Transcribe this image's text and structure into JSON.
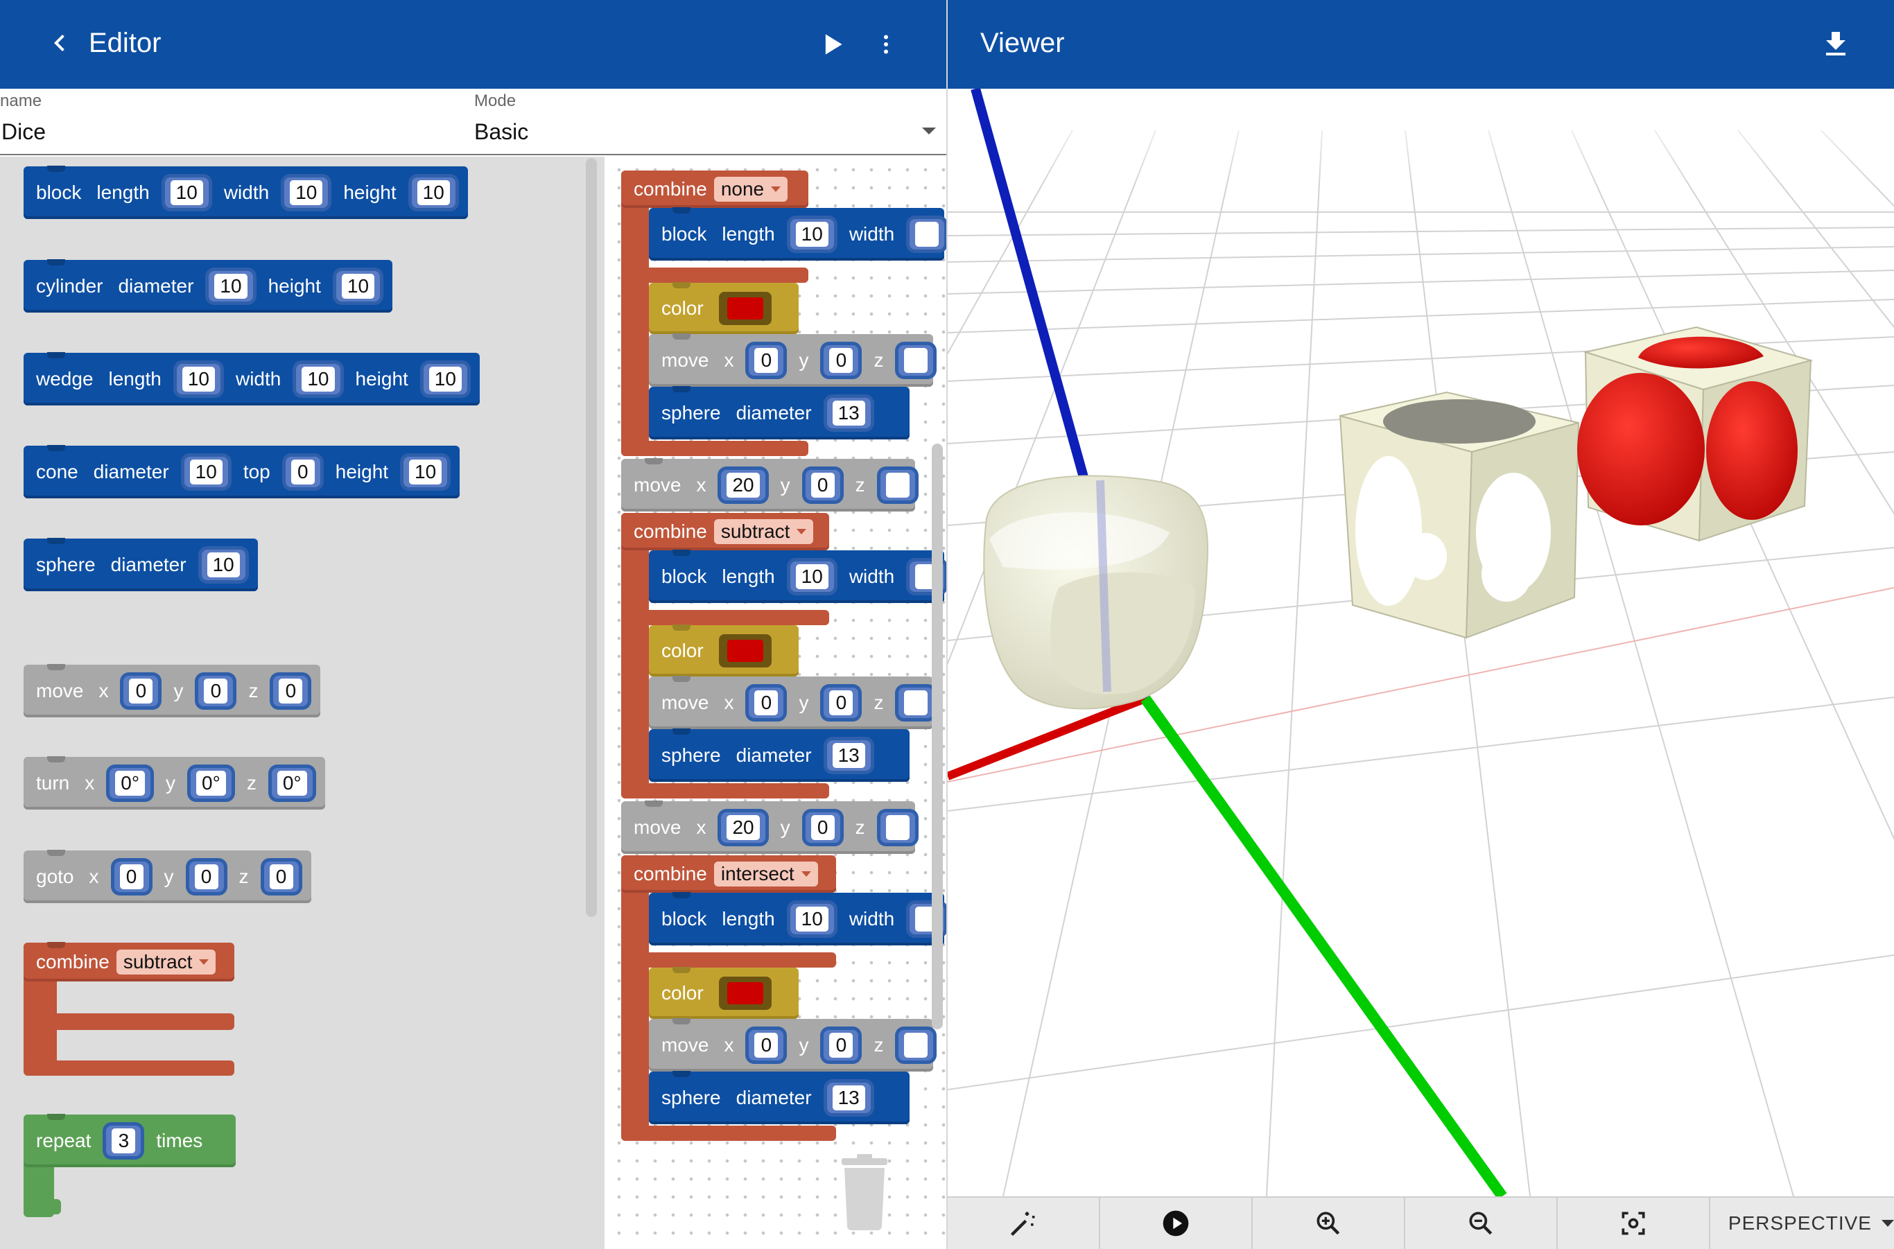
{
  "editor": {
    "title": "Editor",
    "back_icon": "chevron-left-icon",
    "run_icon": "play-icon",
    "menu_icon": "more-vert-icon"
  },
  "viewer": {
    "title": "Viewer",
    "download_icon": "download-icon"
  },
  "form": {
    "name_label": "name",
    "name_value": "Dice",
    "mode_label": "Mode",
    "mode_value": "Basic"
  },
  "colors": {
    "appbar": "#0d4fa3",
    "shape_block": "#0d4fa3",
    "transform_block": "#a8a8a8",
    "color_block": "#c2a22e",
    "combine_block": "#c0553a",
    "loop_block": "#5ba155",
    "swatch_red": "#cc0000"
  },
  "flyout": {
    "block": {
      "kw": "block",
      "length_label": "length",
      "length": "10",
      "width_label": "width",
      "width": "10",
      "height_label": "height",
      "height": "10"
    },
    "cylinder": {
      "kw": "cylinder",
      "diameter_label": "diameter",
      "diameter": "10",
      "height_label": "height",
      "height": "10"
    },
    "wedge": {
      "kw": "wedge",
      "length_label": "length",
      "length": "10",
      "width_label": "width",
      "width": "10",
      "height_label": "height",
      "height": "10"
    },
    "cone": {
      "kw": "cone",
      "diameter_label": "diameter",
      "diameter": "10",
      "top_label": "top",
      "top": "0",
      "height_label": "height",
      "height": "10"
    },
    "sphere": {
      "kw": "sphere",
      "diameter_label": "diameter",
      "diameter": "10"
    },
    "move": {
      "kw": "move",
      "x_label": "x",
      "x": "0",
      "y_label": "y",
      "y": "0",
      "z_label": "z",
      "z": "0"
    },
    "turn": {
      "kw": "turn",
      "x_label": "x",
      "x": "0°",
      "y_label": "y",
      "y": "0°",
      "z_label": "z",
      "z": "0°"
    },
    "goto": {
      "kw": "goto",
      "x_label": "x",
      "x": "0",
      "y_label": "y",
      "y": "0",
      "z_label": "z",
      "z": "0"
    },
    "combine": {
      "kw": "combine",
      "mode": "subtract"
    },
    "repeat": {
      "kw": "repeat",
      "count": "3",
      "suffix": "times"
    }
  },
  "program": {
    "group1": {
      "combine_kw": "combine",
      "combine_mode": "none",
      "block_kw": "block",
      "length_label": "length",
      "length": "10",
      "width_label": "width",
      "color_kw": "color",
      "move_kw": "move",
      "x_label": "x",
      "x": "0",
      "y_label": "y",
      "y": "0",
      "z_label": "z",
      "sphere_kw": "sphere",
      "diameter_label": "diameter",
      "diameter": "13"
    },
    "move1": {
      "kw": "move",
      "x_label": "x",
      "x": "20",
      "y_label": "y",
      "y": "0",
      "z_label": "z"
    },
    "group2": {
      "combine_kw": "combine",
      "combine_mode": "subtract",
      "block_kw": "block",
      "length_label": "length",
      "length": "10",
      "width_label": "width",
      "color_kw": "color",
      "move_kw": "move",
      "x_label": "x",
      "x": "0",
      "y_label": "y",
      "y": "0",
      "z_label": "z",
      "sphere_kw": "sphere",
      "diameter_label": "diameter",
      "diameter": "13"
    },
    "move2": {
      "kw": "move",
      "x_label": "x",
      "x": "20",
      "y_label": "y",
      "y": "0",
      "z_label": "z"
    },
    "group3": {
      "combine_kw": "combine",
      "combine_mode": "intersect",
      "block_kw": "block",
      "length_label": "length",
      "length": "10",
      "width_label": "width",
      "color_kw": "color",
      "move_kw": "move",
      "x_label": "x",
      "x": "0",
      "y_label": "y",
      "y": "0",
      "z_label": "z",
      "sphere_kw": "sphere",
      "diameter_label": "diameter",
      "diameter": "13"
    }
  },
  "toolbar": {
    "magic_icon": "magic-wand-icon",
    "play_icon": "play-circle-icon",
    "zoom_in_icon": "zoom-in-icon",
    "zoom_out_icon": "zoom-out-icon",
    "focus_icon": "center-focus-icon",
    "camera_mode": "PERSPECTIVE"
  }
}
